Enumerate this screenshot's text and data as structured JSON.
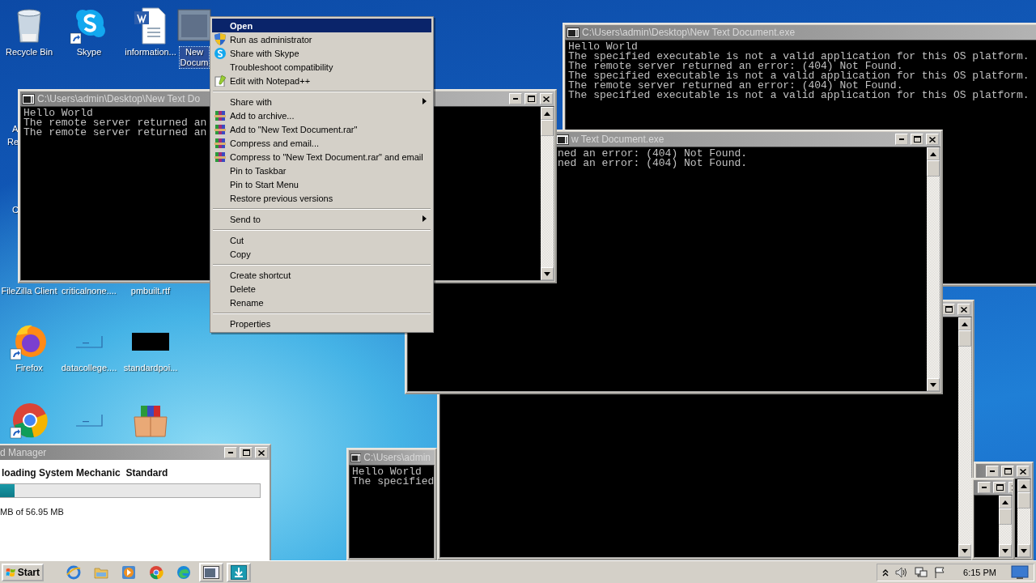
{
  "desktop_icons": [
    {
      "label": "Recycle Bin",
      "kind": "bin",
      "selected": false
    },
    {
      "label": "Skype",
      "kind": "chat",
      "selected": false
    },
    {
      "label": "information...",
      "kind": "document",
      "selected": false
    },
    {
      "label": "New Docum",
      "kind": "window",
      "selected": true
    },
    {
      "label": "FileZilla Client",
      "kind": "none",
      "selected": false
    },
    {
      "label": "criticalnone....",
      "kind": "none",
      "selected": false
    },
    {
      "label": "pmbuilt.rtf",
      "kind": "none",
      "selected": false
    },
    {
      "label": "Firefox",
      "kind": "firefox",
      "selected": false
    },
    {
      "label": "datacollege....",
      "kind": "blank",
      "selected": false
    },
    {
      "label": "standardpoi...",
      "kind": "black",
      "selected": false
    },
    {
      "kind": "chrome",
      "selected": false
    },
    {
      "kind": "blank",
      "selected": false
    },
    {
      "kind": "package",
      "selected": false
    }
  ],
  "icon_label_fragments": [
    "A",
    "Re",
    "C"
  ],
  "console_windows": [
    {
      "kind": "console",
      "title": "C:\\Users\\admin",
      "lines": [
        "Hello World",
        "The specified"
      ]
    },
    {
      "kind": "console"
    },
    {
      "kind": "console",
      "title": "C:\\Users\\admin\\Desktop\\New Text Document.exe",
      "lines": [
        "Hello World",
        "The specified executable is not a valid application for this OS platform.",
        "The remote server returned an error: (404) Not Found.",
        "The specified executable is not a valid application for this OS platform.",
        "The remote server returned an error: (404) Not Found.",
        "The specified executable is not a valid application for this OS platform."
      ]
    },
    {
      "kind": "console",
      "title": "w Text Document.exe",
      "lines": [
        "ned an error: (404) Not Found.",
        "ned an error: (404) Not Found."
      ]
    },
    {
      "kind": "console",
      "title": "C:\\Users\\admin\\Desktop\\New Text Do",
      "lines": [
        "Hello World",
        "The remote server returned an",
        "The remote server returned an"
      ]
    },
    {
      "kind": "console"
    },
    {
      "kind": "console"
    }
  ],
  "download_manager": {
    "title": "d Manager",
    "heading": "loading System Mechanic  Standard",
    "level": 0.06,
    "progress_text": "MB of 56.95 MB"
  },
  "context_menu": {
    "items": [
      {
        "kind": "item",
        "label": "Open",
        "default": true,
        "selected": true,
        "submenu": false
      },
      {
        "kind": "item",
        "label": "Run as administrator",
        "default": false,
        "selected": false,
        "submenu": false
      },
      {
        "kind": "item",
        "label": "Share with Skype",
        "default": false,
        "selected": false,
        "submenu": false
      },
      {
        "kind": "item",
        "label": "Troubleshoot compatibility",
        "default": false,
        "selected": false,
        "submenu": false
      },
      {
        "kind": "item",
        "label": "Edit with Notepad++",
        "default": false,
        "selected": false,
        "submenu": false
      },
      {
        "kind": "separator"
      },
      {
        "kind": "item",
        "label": "Share with",
        "default": false,
        "selected": false,
        "submenu": true
      },
      {
        "kind": "item",
        "label": "Add to archive...",
        "default": false,
        "selected": false,
        "submenu": false
      },
      {
        "kind": "item",
        "label": "Add to \"New Text Document.rar\"",
        "default": false,
        "selected": false,
        "submenu": false
      },
      {
        "kind": "item",
        "label": "Compress and email...",
        "default": false,
        "selected": false,
        "submenu": false
      },
      {
        "kind": "item",
        "label": "Compress to \"New Text Document.rar\" and email",
        "default": false,
        "selected": false,
        "submenu": false
      },
      {
        "kind": "item",
        "label": "Pin to Taskbar",
        "default": false,
        "selected": false,
        "submenu": false
      },
      {
        "kind": "item",
        "label": "Pin to Start Menu",
        "default": false,
        "selected": false,
        "submenu": false
      },
      {
        "kind": "item",
        "label": "Restore previous versions",
        "default": false,
        "selected": false,
        "submenu": false
      },
      {
        "kind": "separator"
      },
      {
        "kind": "item",
        "label": "Send to",
        "default": false,
        "selected": false,
        "submenu": true
      },
      {
        "kind": "separator"
      },
      {
        "kind": "item",
        "label": "Cut",
        "default": false,
        "selected": false,
        "submenu": false
      },
      {
        "kind": "item",
        "label": "Copy",
        "default": false,
        "selected": false,
        "submenu": false
      },
      {
        "kind": "separator"
      },
      {
        "kind": "item",
        "label": "Create shortcut",
        "default": false,
        "selected": false,
        "submenu": false
      },
      {
        "kind": "item",
        "label": "Delete",
        "default": false,
        "selected": false,
        "submenu": false
      },
      {
        "kind": "item",
        "label": "Rename",
        "default": false,
        "selected": false,
        "submenu": false
      },
      {
        "kind": "separator"
      },
      {
        "kind": "item",
        "label": "Properties",
        "default": false,
        "selected": false,
        "submenu": false
      }
    ]
  },
  "taskbar": {
    "start_label": "Start",
    "apps": [
      {
        "kind": "ie",
        "active": false
      },
      {
        "kind": "folder",
        "active": false
      },
      {
        "kind": "media",
        "active": false
      },
      {
        "kind": "chrome",
        "active": false
      },
      {
        "kind": "edge",
        "active": false
      },
      {
        "kind": "console",
        "active": true
      },
      {
        "kind": "download",
        "active": true
      }
    ],
    "clock": "6:15 PM"
  }
}
